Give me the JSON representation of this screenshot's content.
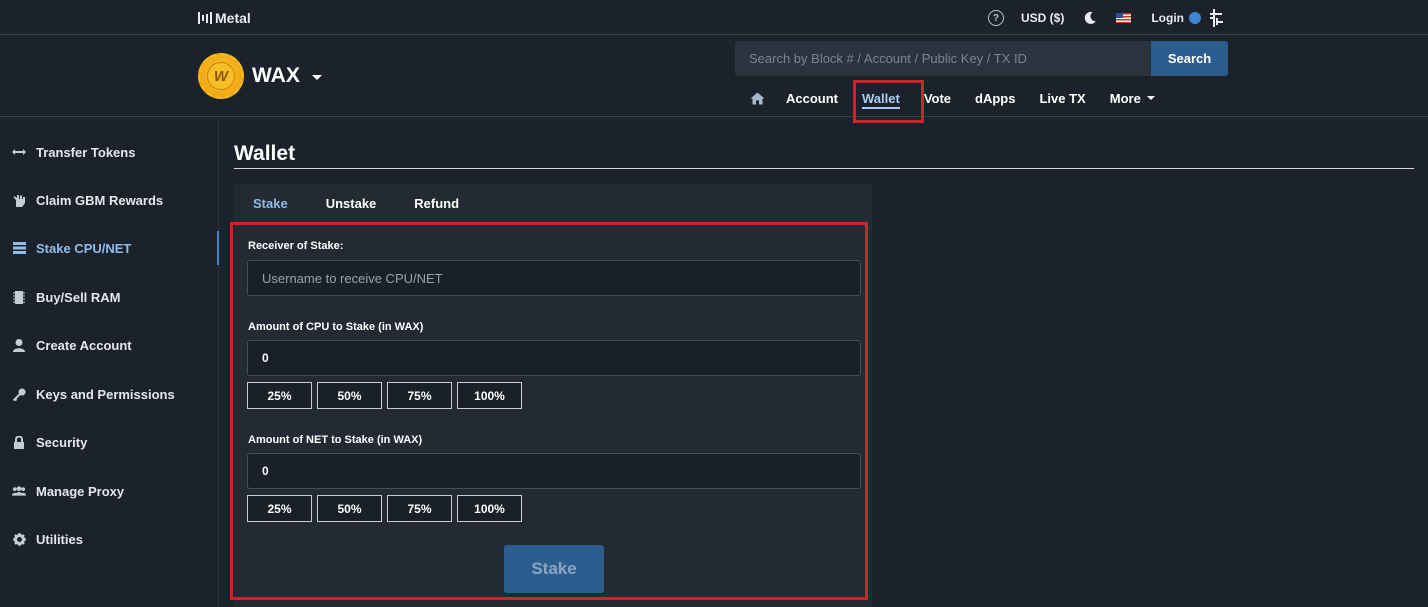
{
  "topbar": {
    "brand": "Metal",
    "currency": "USD ($)",
    "login_label": "Login",
    "icons": [
      "help-icon",
      "moon-icon",
      "us-flag-icon",
      "globe-icon",
      "antelope-icon"
    ]
  },
  "header": {
    "chain_name": "WAX",
    "search": {
      "placeholder": "Search by Block # / Account / Public Key / TX ID",
      "value": "",
      "button_label": "Search"
    },
    "nav": {
      "home": "home-icon",
      "items": [
        "Account",
        "Wallet",
        "Vote",
        "dApps",
        "Live TX",
        "More"
      ],
      "active": "Wallet"
    }
  },
  "sidebar": {
    "items": [
      {
        "label": "Transfer Tokens",
        "icon": "arrows-icon"
      },
      {
        "label": "Claim GBM Rewards",
        "icon": "hand-icon"
      },
      {
        "label": "Stake CPU/NET",
        "icon": "server-icon"
      },
      {
        "label": "Buy/Sell RAM",
        "icon": "chip-icon"
      },
      {
        "label": "Create Account",
        "icon": "user-icon"
      },
      {
        "label": "Keys and Permissions",
        "icon": "key-icon"
      },
      {
        "label": "Security",
        "icon": "lock-icon"
      },
      {
        "label": "Manage Proxy",
        "icon": "users-icon"
      },
      {
        "label": "Utilities",
        "icon": "gear-icon"
      }
    ],
    "active": "Stake CPU/NET"
  },
  "main": {
    "title": "Wallet",
    "tabs": [
      "Stake",
      "Unstake",
      "Refund"
    ],
    "active_tab": "Stake",
    "form": {
      "receiver_label": "Receiver of Stake:",
      "receiver_placeholder": "Username to receive CPU/NET",
      "receiver_value": "",
      "cpu_label": "Amount of CPU to Stake (in WAX)",
      "cpu_value": "0",
      "net_label": "Amount of NET to Stake (in WAX)",
      "net_value": "0",
      "percent_options": [
        "25%",
        "50%",
        "75%",
        "100%"
      ],
      "submit_label": "Stake"
    }
  },
  "colors": {
    "background": "#1c222b",
    "panel": "#232a34",
    "accent": "#2b5d8f",
    "active_text": "#8ebde9",
    "highlight": "#d1232a"
  }
}
